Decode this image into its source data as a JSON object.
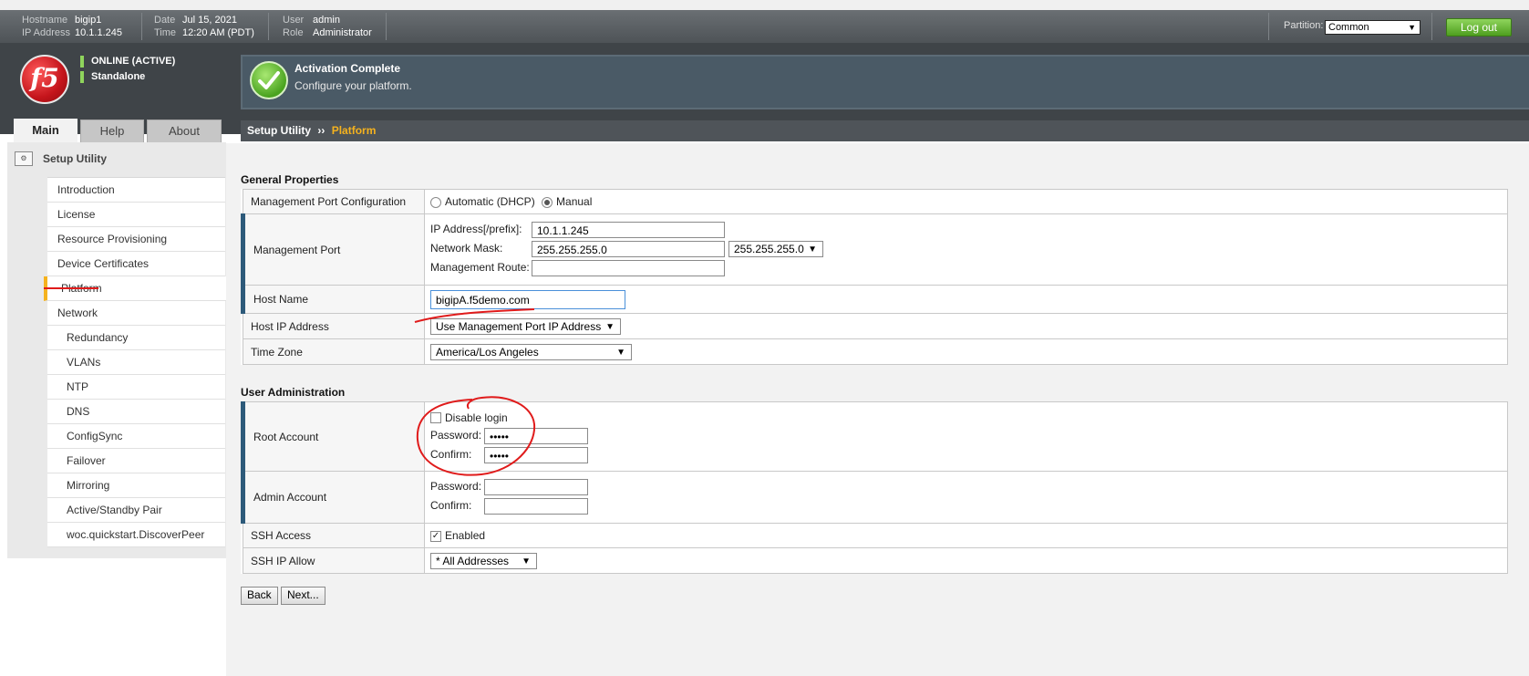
{
  "header": {
    "hostname_label": "Hostname",
    "hostname": "bigip1",
    "ip_label": "IP Address",
    "ip": "10.1.1.245",
    "date_label": "Date",
    "date": "Jul 15, 2021",
    "time_label": "Time",
    "time": "12:20 AM (PDT)",
    "user_label": "User",
    "user": "admin",
    "role_label": "Role",
    "role": "Administrator",
    "partition_label": "Partition:",
    "partition_value": "Common",
    "logout_label": "Log out"
  },
  "device_status": {
    "online": "ONLINE (ACTIVE)",
    "mode": "Standalone"
  },
  "logo_text": "f5",
  "message": {
    "title": "Activation Complete",
    "body": "Configure your platform."
  },
  "tabs": [
    "Main",
    "Help",
    "About"
  ],
  "sidebar": {
    "section_title": "Setup Utility",
    "items": [
      {
        "label": "Introduction"
      },
      {
        "label": "License"
      },
      {
        "label": "Resource Provisioning"
      },
      {
        "label": "Device Certificates"
      },
      {
        "label": "Platform"
      },
      {
        "label": "Network"
      },
      {
        "label": "Redundancy"
      },
      {
        "label": "VLANs"
      },
      {
        "label": "NTP"
      },
      {
        "label": "DNS"
      },
      {
        "label": "ConfigSync"
      },
      {
        "label": "Failover"
      },
      {
        "label": "Mirroring"
      },
      {
        "label": "Active/Standby Pair"
      },
      {
        "label": "woc.quickstart.DiscoverPeer"
      }
    ]
  },
  "breadcrumb": {
    "parent": "Setup Utility",
    "separator": "››",
    "current": "Platform"
  },
  "general": {
    "title": "General Properties",
    "mgmt_port_config_label": "Management Port Configuration",
    "radio_auto": "Automatic (DHCP)",
    "radio_manual": "Manual",
    "mgmt_port_label": "Management Port",
    "ip_prefix_label": "IP Address[/prefix]:",
    "ip_prefix_value": "10.1.1.245",
    "netmask_label": "Network Mask:",
    "netmask_value": "255.255.255.0",
    "netmask_select": "255.255.255.0",
    "mgmt_route_label": "Management Route:",
    "mgmt_route_value": "",
    "hostname_label": "Host Name",
    "hostname_value": "bigipA.f5demo.com",
    "host_ip_label": "Host IP Address",
    "host_ip_value": "Use Management Port IP Address",
    "timezone_label": "Time Zone",
    "timezone_value": "America/Los Angeles"
  },
  "user_admin": {
    "title": "User Administration",
    "root_label": "Root Account",
    "disable_login": "Disable login",
    "password_label": "Password:",
    "root_password": "•••••",
    "confirm_label": "Confirm:",
    "root_confirm": "•••••",
    "admin_label": "Admin Account",
    "ssh_label": "SSH Access",
    "ssh_enabled": "Enabled",
    "ssh_ip_label": "SSH IP Allow",
    "ssh_ip_value": "* All Addresses"
  },
  "buttons": {
    "back": "Back",
    "next": "Next..."
  },
  "colors": {
    "accent_yellow": "#f5b21e",
    "annotation_red": "#e01b1b",
    "online_green": "#8fd45c"
  }
}
